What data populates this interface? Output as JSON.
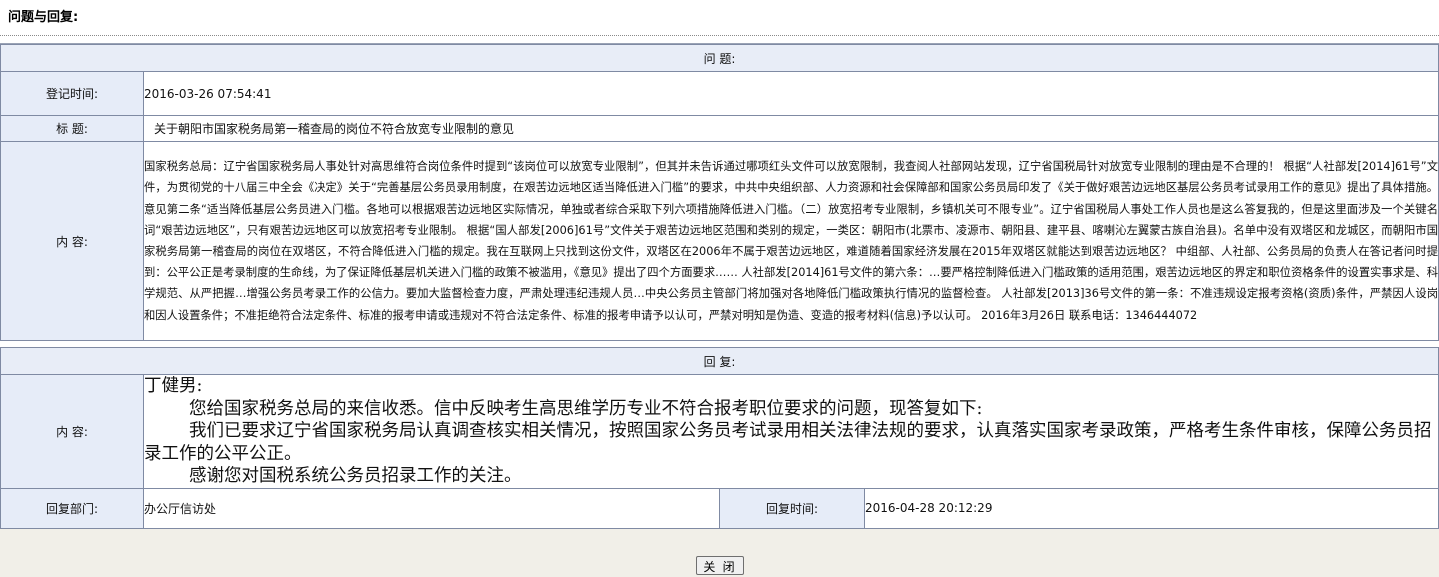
{
  "page_title": "问题与回复:",
  "question": {
    "section_label": "问 题:",
    "register_time_label": "登记时间:",
    "register_time": "2016-03-26 07:54:41",
    "subject_label": "标 题:",
    "subject": "关于朝阳市国家税务局第一稽查局的岗位不符合放宽专业限制的意见",
    "content_label": "内 容:",
    "content": "国家税务总局：辽宁省国家税务局人事处针对高思维符合岗位条件时提到“该岗位可以放宽专业限制”，但其并未告诉通过哪项红头文件可以放宽限制，我查阅人社部网站发现，辽宁省国税局针对放宽专业限制的理由是不合理的！ 根据“人社部发[2014]61号”文件，为贯彻党的十八届三中全会《决定》关于“完善基层公务员录用制度，在艰苦边远地区适当降低进入门槛”的要求，中共中央组织部、人力资源和社会保障部和国家公务员局印发了《关于做好艰苦边远地区基层公务员考试录用工作的意见》提出了具体措施。 意见第二条“适当降低基层公务员进入门槛。各地可以根据艰苦边远地区实际情况，单独或者综合采取下列六项措施降低进入门槛。（二）放宽招考专业限制，乡镇机关可不限专业”。辽宁省国税局人事处工作人员也是这么答复我的，但是这里面涉及一个关键名词“艰苦边远地区”，只有艰苦边远地区可以放宽招考专业限制。 根据“国人部发[2006]61号”文件关于艰苦边远地区范围和类别的规定，一类区：朝阳市(北票市、凌源市、朝阳县、建平县、喀喇沁左翼蒙古族自治县)。名单中没有双塔区和龙城区，而朝阳市国家税务局第一稽查局的岗位在双塔区，不符合降低进入门槛的规定。我在互联网上只找到这份文件，双塔区在2006年不属于艰苦边远地区，难道随着国家经济发展在2015年双塔区就能达到艰苦边远地区？ 中组部、人社部、公务员局的负责人在答记者问时提到：公平公正是考录制度的生命线，为了保证降低基层机关进入门槛的政策不被滥用，《意见》提出了四个方面要求…… 人社部发[2014]61号文件的第六条：…要严格控制降低进入门槛政策的适用范围，艰苦边远地区的界定和职位资格条件的设置实事求是、科学规范、从严把握…增强公务员考录工作的公信力。要加大监督检查力度，严肃处理违纪违规人员…中央公务员主管部门将加强对各地降低门槛政策执行情况的监督检查。 人社部发[2013]36号文件的第一条：不准违规设定报考资格(资质)条件，严禁因人设岗和因人设置条件；不准拒绝符合法定条件、标准的报考申请或违规对不符合法定条件、标准的报考申请予以认可，严禁对明知是伪造、变造的报考材料(信息)予以认可。 2016年3月26日 联系电话：1346444072"
  },
  "answer": {
    "section_label": "回 复:",
    "content_label": "内 容:",
    "greeting": "丁健男:",
    "paragraphs": [
      "您给国家税务总局的来信收悉。信中反映考生高思维学历专业不符合报考职位要求的问题，现答复如下:",
      "我们已要求辽宁省国家税务局认真调查核实相关情况，按照国家公务员考试录用相关法律法规的要求，认真落实国家考录政策，严格考生条件审核，保障公务员招录工作的公平公正。",
      "感谢您对国税系统公务员招录工作的关注。"
    ],
    "dept_label": "回复部门:",
    "dept": "办公厅信访处",
    "time_label": "回复时间:",
    "time": "2016-04-28 20:12:29"
  },
  "close_button": "关 闭"
}
